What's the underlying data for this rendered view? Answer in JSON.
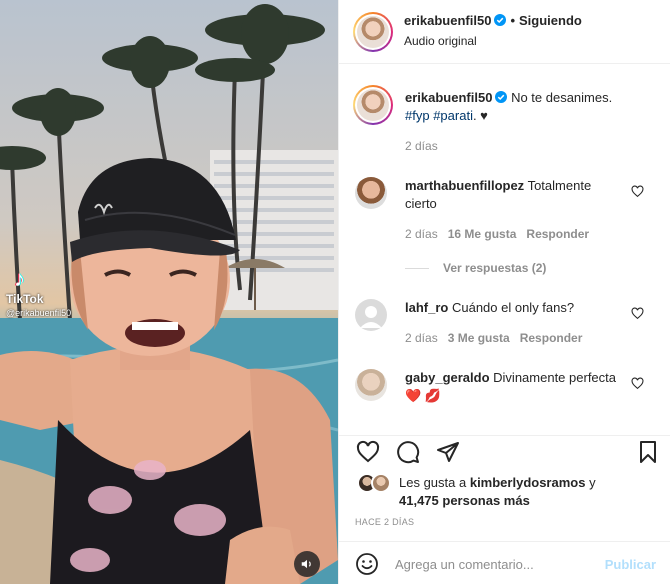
{
  "colors": {
    "link": "#00376b",
    "verified": "#0095f6",
    "muted": "#8e8e8e",
    "publish_disabled": "#b2dffc",
    "heart_red": "#ed4956"
  },
  "media": {
    "watermark_logo": "♪",
    "watermark_name": "TikTok",
    "watermark_handle": "@erikabuenfil50",
    "audio_icon": "speaker-icon"
  },
  "header": {
    "username": "erikabuenfil50",
    "separator": "•",
    "follow_label": "Siguiendo",
    "subtitle": "Audio original"
  },
  "caption": {
    "username": "erikabuenfil50",
    "text": "No te desanimes.",
    "tag1": "#fyp",
    "tag2": "#parati",
    "tail": ". ♥",
    "time": "2 días"
  },
  "comments": [
    {
      "user": "marthabuenfillopez",
      "text": "Totalmente cierto",
      "time": "2 días",
      "likes": "16 Me gusta",
      "reply": "Responder",
      "view_replies": "Ver respuestas (2)"
    },
    {
      "user": "lahf_ro",
      "text": "Cuándo el only fans?",
      "time": "2 días",
      "likes": "3 Me gusta",
      "reply": "Responder"
    },
    {
      "user": "gaby_geraldo",
      "text": "Divinamente perfecta",
      "emoji": "❤️ 💋"
    }
  ],
  "likes": {
    "prefix": "Les gusta a",
    "user": "kimberlydosramos",
    "joiner": "y",
    "count": "41,475 personas más"
  },
  "timestamp": "HACE 2 DÍAS",
  "add_comment": {
    "placeholder": "Agrega un comentario...",
    "publish_label": "Publicar"
  }
}
